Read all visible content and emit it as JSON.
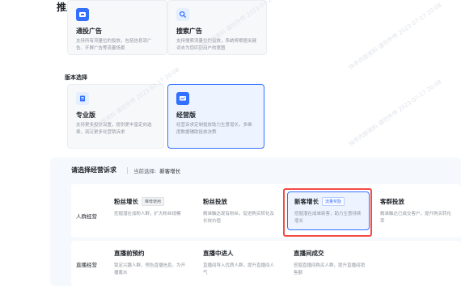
{
  "page_title": "推广设置",
  "campaign_types": [
    {
      "title": "通投广告",
      "desc": "支持所有流量位的投放，包括信息流广告、开屏广告等流量场景",
      "icon": "feed-ad-icon"
    },
    {
      "title": "搜索广告",
      "desc": "支持搜索流量位的投放，系统将根据关键词去为您匹配用户的意图",
      "icon": "search-ad-icon"
    }
  ],
  "version_label": "版本选择",
  "versions": [
    {
      "title": "专业版",
      "desc": "支持更多投放设置，提供更丰富定向选择，满足更多化营销诉求",
      "icon": "pro-version-icon"
    },
    {
      "title": "经营版",
      "desc": "经营诉求定制投放助力生意增长，多维度数据辅助投放决策",
      "icon": "business-version-icon"
    }
  ],
  "objective_panel": {
    "header": "请选择经营诉求",
    "current_label": "当前选择:",
    "current_value": "新客增长",
    "rows": [
      {
        "label": "人群经营",
        "items": [
          {
            "title": "粉丝增长",
            "tag": "推荐使用",
            "desc": "挖掘潜在加粉人群，扩大粉丝规模"
          },
          {
            "title": "粉丝投放",
            "tag": "",
            "desc": "精准触达现有粉丝，促进购买转化及长效价值"
          },
          {
            "title": "新客增长",
            "tag": "流量奖励",
            "desc": "挖掘潜在成单新客，助力生意持续增长"
          },
          {
            "title": "客群投放",
            "tag": "",
            "desc": "精准触达已成交客户，提升购买转化率"
          }
        ]
      },
      {
        "label": "直播经营",
        "items": [
          {
            "title": "直播前预约",
            "tag": "",
            "desc": "锁定兴趣人群，预告直播信息，为开播蓄水"
          },
          {
            "title": "直播中进人",
            "tag": "",
            "desc": "直播间导入优质人群，提升直播间人气"
          },
          {
            "title": "直播间成交",
            "tag": "",
            "desc": "挖掘直播间购买人群，提升直播间销售额"
          }
        ]
      }
    ]
  },
  "watermark": "快手内部资料 请勿外传 2023-07-17 20:08",
  "colors": {
    "accent": "#3370ff",
    "highlight": "#f54a45"
  }
}
